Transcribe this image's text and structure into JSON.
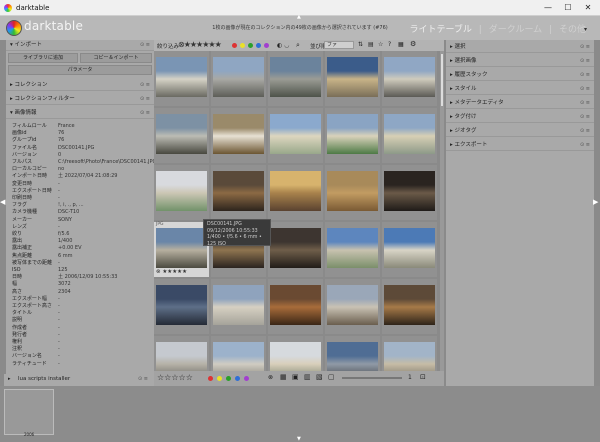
{
  "window": {
    "title": "darktable",
    "minimize": "—",
    "maximize": "☐",
    "close": "✕"
  },
  "header": {
    "brand": "darktable",
    "collection_text": "1枚の画像が現在のコレクション内の49枚の画像から選択されています (#76)",
    "views": {
      "lighttable": "ライトテーブル",
      "sep1": "|",
      "darkroom": "ダークルーム",
      "sep2": "|",
      "other": "その他"
    },
    "menu": "▾"
  },
  "left": {
    "import": {
      "label": "インポート",
      "add_to_library": "ライブラリに追加",
      "copy_import": "コピー＆インポート",
      "params": "パラメータ"
    },
    "modules": [
      "コレクション",
      "コレクションフィルター",
      "画像情報"
    ],
    "info": [
      {
        "k": "フィルムロール",
        "v": "France"
      },
      {
        "k": "画像id",
        "v": "76"
      },
      {
        "k": "グループid",
        "v": "76"
      },
      {
        "k": "ファイル名",
        "v": "DSC00141.JPG"
      },
      {
        "k": "バージョン",
        "v": "0"
      },
      {
        "k": "フルパス",
        "v": "C:\\freesoft\\Photo\\France\\DSC00141.JPG"
      },
      {
        "k": "ローカルコピー",
        "v": "no"
      },
      {
        "k": "インポート日時",
        "v": "土 2022/07/04 21:08:29"
      },
      {
        "k": "変更日時",
        "v": "-"
      },
      {
        "k": "エクスポート日時",
        "v": "-"
      },
      {
        "k": "印刷日時",
        "v": "-"
      },
      {
        "k": "フラグ",
        "v": "!, i, ., p, ..."
      },
      {
        "k": "カメラ機種",
        "v": "DSC-T10"
      },
      {
        "k": "メーカー",
        "v": "SONY"
      },
      {
        "k": "レンズ",
        "v": "-"
      },
      {
        "k": "絞り",
        "v": "f/5.6"
      },
      {
        "k": "露出",
        "v": "1/400"
      },
      {
        "k": "露出補正",
        "v": "+0.00 EV"
      },
      {
        "k": "焦点距離",
        "v": "6 mm"
      },
      {
        "k": "被写体までの距離",
        "v": "-"
      },
      {
        "k": "ISO",
        "v": "125"
      },
      {
        "k": "日時",
        "v": "土 2006/12/09 10:55:33"
      },
      {
        "k": "幅",
        "v": "3072"
      },
      {
        "k": "高さ",
        "v": "2304"
      },
      {
        "k": "エクスポート幅",
        "v": "-"
      },
      {
        "k": "エクスポート高さ",
        "v": "-"
      },
      {
        "k": "タイトル",
        "v": "-"
      },
      {
        "k": "説明",
        "v": "-"
      },
      {
        "k": "作成者",
        "v": "-"
      },
      {
        "k": "発行者",
        "v": "-"
      },
      {
        "k": "権利",
        "v": "-"
      },
      {
        "k": "注釈",
        "v": "-"
      },
      {
        "k": "バージョン名",
        "v": "-"
      },
      {
        "k": "ラティチュード",
        "v": "-"
      }
    ],
    "lua": "lua scripts installer"
  },
  "center": {
    "sort_label": "絞り込み",
    "order_label": "並び順",
    "order_value": "ファ",
    "selected_index": 17,
    "tooltip": {
      "line1": "DSC00141.JPG",
      "line2": "09/12/2006 10:55:33",
      "line3": "1/400 • f/5.6 • 6 mm • 125 ISO"
    },
    "jpg_label": "JPG",
    "colors": [
      "#d33",
      "#e9e028",
      "#2aa02a",
      "#2f6fd6",
      "#a23fcf"
    ],
    "thumbs": [
      [
        "#7a95b4",
        "#d5d2c6",
        "#6a6a62"
      ],
      [
        "#8fa6c2",
        "#a9a9a4",
        "#5d5e58"
      ],
      [
        "#6b839c",
        "#9b9c95",
        "#4e534a"
      ],
      [
        "#3b5c8a",
        "#c8b488",
        "#7a6e58"
      ],
      [
        "#90a7c4",
        "#cfcbbd",
        "#5b5a55"
      ],
      [
        "#7d91a4",
        "#bcbcb4",
        "#48483f"
      ],
      [
        "#9a8a6a",
        "#e7e1d4",
        "#6b5532"
      ],
      [
        "#8ba9cd",
        "#ddd6bf",
        "#98a78a"
      ],
      [
        "#8aa4c3",
        "#d9d2bb",
        "#4d7a45"
      ],
      [
        "#8ea7c5",
        "#d7cfb5",
        "#8d9988"
      ],
      [
        "#d8dade",
        "#ccc6b4",
        "#72926a"
      ],
      [
        "#5a4a3a",
        "#8c6a44",
        "#2d241d"
      ],
      [
        "#d7b36d",
        "#a8824c",
        "#5a4230"
      ],
      [
        "#a88a5a",
        "#c29c62",
        "#7a5a34"
      ],
      [
        "#2a2420",
        "#6b5a48",
        "#1f1b18"
      ],
      [
        "#6a86a8",
        "#b7b0a0",
        "#4b4a40"
      ],
      [
        "#433a33",
        "#8f7550",
        "#2a231f"
      ],
      [
        "#3d3530",
        "#6f5e4a",
        "#211c18"
      ],
      [
        "#5d86be",
        "#c8c2b0",
        "#7b8f6a"
      ],
      [
        "#4c7ab6",
        "#d8d4c6",
        "#8a8a7a"
      ],
      [
        "#3a4a66",
        "#5e6f88",
        "#242a36"
      ],
      [
        "#8fa3bd",
        "#d6d0c2",
        "#a5a39a"
      ],
      [
        "#6a4a32",
        "#a86c3a",
        "#3a2616"
      ],
      [
        "#9aa7b8",
        "#c9c2b4",
        "#6a5e4e"
      ],
      [
        "#5d4a38",
        "#a67a48",
        "#2e2419"
      ],
      [
        "#c5c9cf",
        "#b6b2a8",
        "#5f5f59"
      ],
      [
        "#9cb2cb",
        "#d0ccc2",
        "#7a786e"
      ],
      [
        "#d6dade",
        "#d8cfbb",
        "#6e7a66"
      ],
      [
        "#4f6d94",
        "#909aa6",
        "#3a3c40"
      ],
      [
        "#a2b4c8",
        "#c6bca6",
        "#6f6a5e"
      ]
    ]
  },
  "right": {
    "modules": [
      "選択",
      "選択画像",
      "履歴スタック",
      "スタイル",
      "メタデータエディタ",
      "タグ付け",
      "ジオタグ",
      "エクスポート"
    ]
  },
  "bottom": {
    "stars": "☆☆☆☆☆",
    "page": "1",
    "strip_label": "2006"
  }
}
